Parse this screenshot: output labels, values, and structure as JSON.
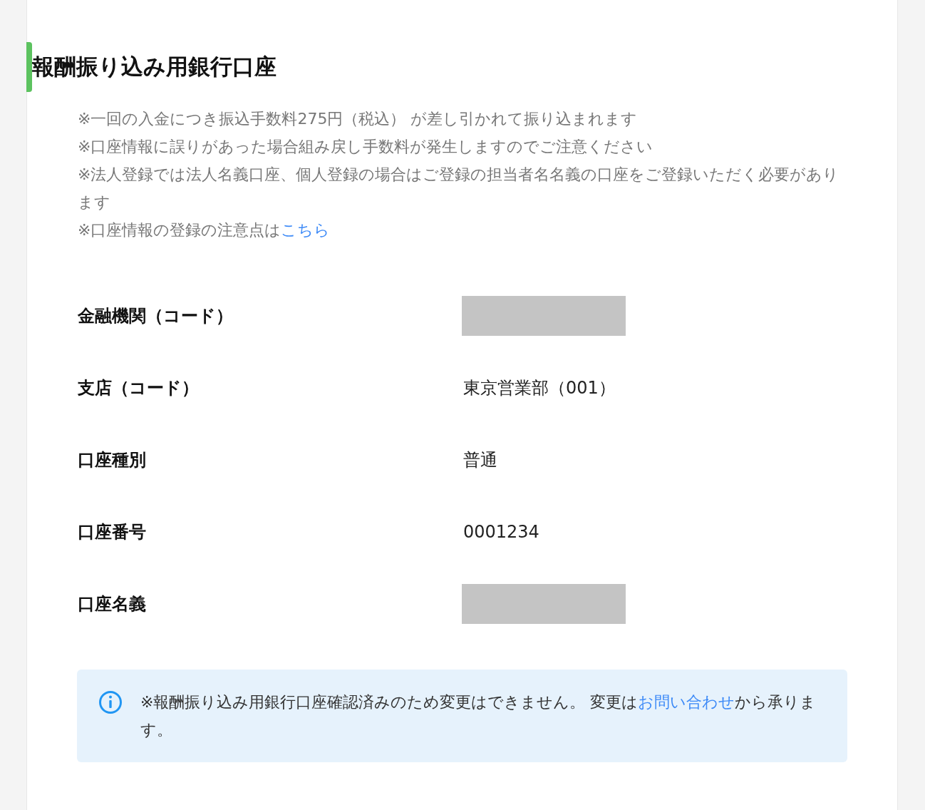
{
  "section": {
    "title": "報酬振り込み用銀行口座"
  },
  "notes": [
    {
      "text": "※一回の入金につき振込手数料275円（税込） が差し引かれて振り込まれます"
    },
    {
      "text": "※口座情報に誤りがあった場合組み戻し手数料が発生しますのでご注意ください"
    },
    {
      "text": "※法人登録では法人名義口座、個人登録の場合はご登録の担当者名名義の口座をご登録いただく必要があります"
    },
    {
      "text": "※口座情報の登録の注意点は",
      "link": "こちら"
    }
  ],
  "fields": [
    {
      "label": "金融機関（コード）",
      "kind": "redacted"
    },
    {
      "label": "支店（コード）",
      "kind": "text",
      "value": "東京営業部（001）"
    },
    {
      "label": "口座種別",
      "kind": "text",
      "value": "普通"
    },
    {
      "label": "口座番号",
      "kind": "text",
      "value": "0001234"
    },
    {
      "label": "口座名義",
      "kind": "redacted"
    }
  ],
  "info": {
    "before": "※報酬振り込み用銀行口座確認済みのため変更はできません。 変更は",
    "link": "お問い合わせ",
    "after": "から承ります。"
  }
}
